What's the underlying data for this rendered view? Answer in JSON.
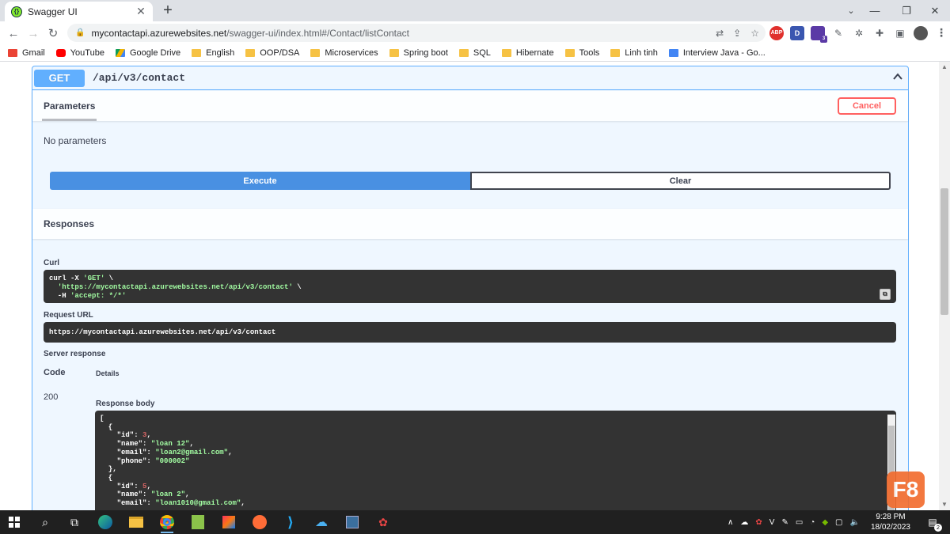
{
  "browser": {
    "tab_title": "Swagger UI",
    "tab_favicon": "swagger-icon",
    "url_host": "mycontactapi.azurewebsites.net",
    "url_path": "/swagger-ui/index.html#/Contact/listContact"
  },
  "bookmarks": [
    {
      "label": "Gmail",
      "icon": "gmail-icon"
    },
    {
      "label": "YouTube",
      "icon": "youtube-icon"
    },
    {
      "label": "Google Drive",
      "icon": "google-drive-icon"
    },
    {
      "label": "English",
      "icon": "folder-icon"
    },
    {
      "label": "OOP/DSA",
      "icon": "folder-icon"
    },
    {
      "label": "Microservices",
      "icon": "folder-icon"
    },
    {
      "label": "Spring boot",
      "icon": "folder-icon"
    },
    {
      "label": "SQL",
      "icon": "folder-icon"
    },
    {
      "label": "Hibernate",
      "icon": "folder-icon"
    },
    {
      "label": "Tools",
      "icon": "folder-icon"
    },
    {
      "label": "Linh tinh",
      "icon": "folder-icon"
    },
    {
      "label": "Interview Java - Go...",
      "icon": "docs-icon"
    }
  ],
  "extensions": {
    "abp": "ABP",
    "d": "D",
    "badge": "3"
  },
  "operation": {
    "method": "GET",
    "path": "/api/v3/contact",
    "parameters_tab": "Parameters",
    "cancel_label": "Cancel",
    "no_params": "No parameters",
    "execute_label": "Execute",
    "clear_label": "Clear",
    "responses_title": "Responses",
    "curl_label": "Curl",
    "curl_line1_prefix": "curl -X ",
    "curl_line1_method": "'GET'",
    "curl_line1_suffix": " \\",
    "curl_line2_url": "'https://mycontactapi.azurewebsites.net/api/v3/contact'",
    "curl_line2_suffix": " \\",
    "curl_line3_prefix": "  -H ",
    "curl_line3_header": "'accept: */*'",
    "request_url_label": "Request URL",
    "request_url": "https://mycontactapi.azurewebsites.net/api/v3/contact",
    "server_response_label": "Server response",
    "code_header": "Code",
    "details_header": "Details",
    "status_code": "200",
    "response_body_label": "Response body"
  },
  "response_body": [
    {
      "id": 3,
      "name": "loan 12",
      "email": "loan2@gmail.com",
      "phone": "000002"
    },
    {
      "id": 5,
      "name": "loan 2",
      "email": "loan1010@gmail.com"
    }
  ],
  "taskbar": {
    "time": "9:28 PM",
    "date": "18/02/2023",
    "notification_count": "2"
  },
  "overlay": {
    "logo": "F8"
  },
  "colors": {
    "get_method": "#61affe",
    "execute": "#4990e2",
    "cancel": "#ff6060",
    "code_bg": "#333333"
  }
}
